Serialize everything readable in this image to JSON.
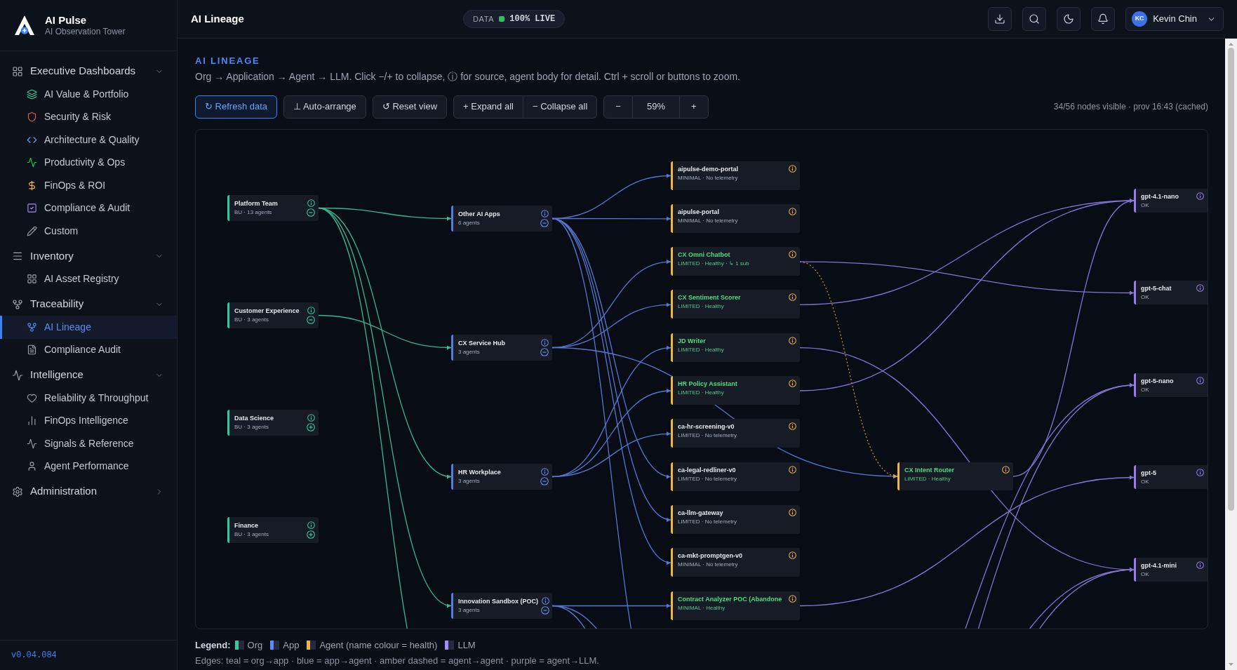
{
  "sidebar": {
    "brand": {
      "name": "AI Pulse",
      "tagline": "AI Observation Tower"
    },
    "sections": [
      {
        "label": "Executive Dashboards",
        "expanded": true,
        "items": [
          {
            "label": "AI Value & Portfolio",
            "selected": false
          },
          {
            "label": "Security & Risk",
            "selected": false
          },
          {
            "label": "Architecture & Quality",
            "selected": false
          },
          {
            "label": "Productivity & Ops",
            "selected": false
          },
          {
            "label": "FinOps & ROI",
            "selected": false
          },
          {
            "label": "Compliance & Audit",
            "selected": false
          },
          {
            "label": "Custom",
            "selected": false
          }
        ]
      },
      {
        "label": "Inventory",
        "expanded": true,
        "items": [
          {
            "label": "AI Asset Registry",
            "selected": false
          }
        ]
      },
      {
        "label": "Traceability",
        "expanded": true,
        "items": [
          {
            "label": "AI Lineage",
            "selected": true
          },
          {
            "label": "Compliance Audit",
            "selected": false
          }
        ]
      },
      {
        "label": "Intelligence",
        "expanded": true,
        "items": [
          {
            "label": "Reliability & Throughput",
            "selected": false
          },
          {
            "label": "FinOps Intelligence",
            "selected": false
          },
          {
            "label": "Signals & Reference",
            "selected": false
          },
          {
            "label": "Agent Performance",
            "selected": false
          }
        ]
      },
      {
        "label": "Administration",
        "expanded": false
      }
    ],
    "version": "v0.04.084"
  },
  "header": {
    "title": "AI Lineage",
    "data_status": {
      "label": "DATA",
      "value": "100% LIVE",
      "live": true
    },
    "user": {
      "initials": "KC",
      "name": "Kevin Chin"
    }
  },
  "page": {
    "heading": "AI LINEAGE",
    "description": "Org → Application → Agent → LLM. Click −/+ to collapse, ⓘ for source, agent body for detail. Ctrl + scroll or buttons to zoom.",
    "toolbar": {
      "actions": [
        {
          "kind": "primary",
          "label": "↻ Refresh data"
        },
        {
          "kind": "default",
          "label": "⊥ Auto-arrange"
        },
        {
          "kind": "default",
          "label": "↺ Reset view"
        }
      ],
      "tree_controls": [
        "+ Expand all",
        "− Collapse all"
      ],
      "zoom": {
        "zoom_out": "−",
        "value": "59%",
        "zoom_in": "+"
      },
      "status": "34/56 nodes visible · prov 16:43 (cached)"
    }
  },
  "canvas": {
    "orgs": [
      {
        "name": "Platform Team",
        "subtitle": "BU · 13 agents",
        "expanded": true
      },
      {
        "name": "Customer Experience",
        "subtitle": "BU · 3 agents",
        "expanded": true
      },
      {
        "name": "Data Science",
        "subtitle": "BU · 3 agents",
        "expanded": false
      },
      {
        "name": "Finance",
        "subtitle": "BU · 3 agents",
        "expanded": false
      }
    ],
    "apps": [
      {
        "name": "Other AI Apps",
        "subtitle": "6 agents",
        "expanded": true
      },
      {
        "name": "CX Service Hub",
        "subtitle": "3 agents",
        "expanded": true
      },
      {
        "name": "HR Workplace",
        "subtitle": "3 agents",
        "expanded": true
      },
      {
        "name": "Innovation Sandbox (POC)",
        "subtitle": "3 agents",
        "expanded": true
      }
    ],
    "agents": [
      {
        "name": "aipulse-demo-portal",
        "subtitle": "MINIMAL · No telemetry",
        "healthy": false
      },
      {
        "name": "aipulse-portal",
        "subtitle": "MINIMAL · No telemetry",
        "healthy": false
      },
      {
        "name": "CX Omni Chatbot",
        "subtitle": "LIMITED · Healthy · ↳ 1 sub",
        "healthy": true
      },
      {
        "name": "CX Sentiment Scorer",
        "subtitle": "LIMITED · Healthy",
        "healthy": true
      },
      {
        "name": "JD Writer",
        "subtitle": "LIMITED · Healthy",
        "healthy": true
      },
      {
        "name": "HR Policy Assistant",
        "subtitle": "LIMITED · Healthy",
        "healthy": true
      },
      {
        "name": "ca-hr-screening-v0",
        "subtitle": "LIMITED · No telemetry",
        "healthy": false
      },
      {
        "name": "ca-legal-redliner-v0",
        "subtitle": "LIMITED · No telemetry",
        "healthy": false
      },
      {
        "name": "ca-llm-gateway",
        "subtitle": "LIMITED · No telemetry",
        "healthy": false
      },
      {
        "name": "ca-mkt-promptgen-v0",
        "subtitle": "MINIMAL · No telemetry",
        "healthy": false
      },
      {
        "name": "Contract Analyzer POC (Abandone",
        "subtitle": "MINIMAL · Healthy",
        "healthy": true
      }
    ],
    "sub_agents": [
      {
        "name": "CX Intent Router",
        "subtitle": "LIMITED · Healthy",
        "healthy": true
      }
    ],
    "llms": [
      {
        "name": "gpt-4.1-nano",
        "subtitle": "OK"
      },
      {
        "name": "gpt-5-chat",
        "subtitle": "OK"
      },
      {
        "name": "gpt-5-nano",
        "subtitle": "OK"
      },
      {
        "name": "gpt-5",
        "subtitle": "OK"
      },
      {
        "name": "gpt-4.1-mini",
        "subtitle": "OK"
      }
    ]
  },
  "legend": {
    "title": "Legend:",
    "items": [
      {
        "label": "Org",
        "color": "#34c89a"
      },
      {
        "label": "App",
        "color": "#5b8def"
      },
      {
        "label": "Agent (name colour = health)",
        "color": "#f0b440"
      },
      {
        "label": "LLM",
        "color": "#a78bfa"
      }
    ],
    "edges_note": "Edges: teal = org→app · blue = app→agent · amber dashed = agent→agent · purple = agent→LLM."
  }
}
